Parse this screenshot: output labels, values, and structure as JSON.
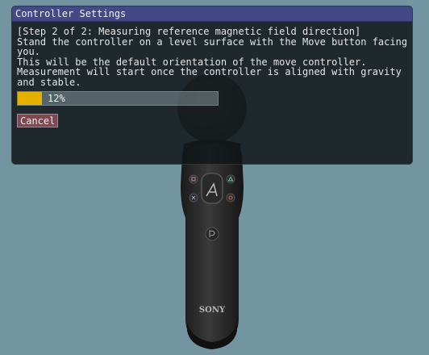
{
  "window": {
    "title": "Controller Settings"
  },
  "instructions": {
    "step": "[Step 2 of 2: Measuring reference magnetic field direction]",
    "line1": "Stand the controller on a level surface with the Move button facing",
    "line2": "you.",
    "line3": "This will be the default orientation of the move controller.",
    "line4": "Measurement will start once the controller is aligned with gravity",
    "line5": "and stable."
  },
  "progress": {
    "value": 0.12,
    "label": "12%"
  },
  "buttons": {
    "cancel": "Cancel"
  },
  "controller": {
    "logo": "SONY"
  },
  "colors": {
    "background": "#7395a1",
    "titlebar": "#454887",
    "progress_fill": "#e6b000",
    "cancel_button": "#7d4950"
  }
}
